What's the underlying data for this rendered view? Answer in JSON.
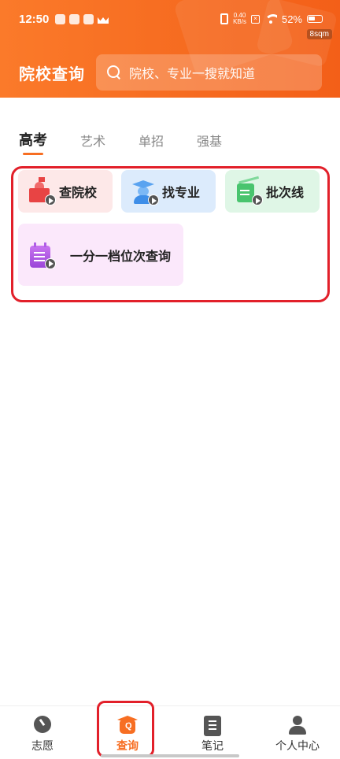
{
  "status_bar": {
    "time": "12:50",
    "net_speed_value": "0.40",
    "net_speed_unit": "KB/s",
    "battery_percent": "52%",
    "corner_badge": "8sqm"
  },
  "header": {
    "title": "院校查询",
    "search_placeholder": "院校、专业一搜就知道",
    "brand_color": "#f76e22"
  },
  "tabs": [
    {
      "label": "高考",
      "active": true
    },
    {
      "label": "艺术",
      "active": false
    },
    {
      "label": "单招",
      "active": false
    },
    {
      "label": "强基",
      "active": false
    }
  ],
  "cards": [
    {
      "label": "查院校",
      "icon": "school-icon",
      "bg": "#fde8e8"
    },
    {
      "label": "找专业",
      "icon": "graduate-icon",
      "bg": "#dcebfc"
    },
    {
      "label": "批次线",
      "icon": "batch-line-icon",
      "bg": "#dff6e6"
    },
    {
      "label": "一分一档位次查询",
      "icon": "rank-list-icon",
      "bg": "#fbe8fb"
    }
  ],
  "bottom_nav": [
    {
      "label": "志愿",
      "icon": "volunteer-icon",
      "active": false
    },
    {
      "label": "查询",
      "icon": "query-icon",
      "active": true
    },
    {
      "label": "笔记",
      "icon": "notes-icon",
      "active": false
    },
    {
      "label": "个人中心",
      "icon": "person-icon",
      "active": false
    }
  ]
}
